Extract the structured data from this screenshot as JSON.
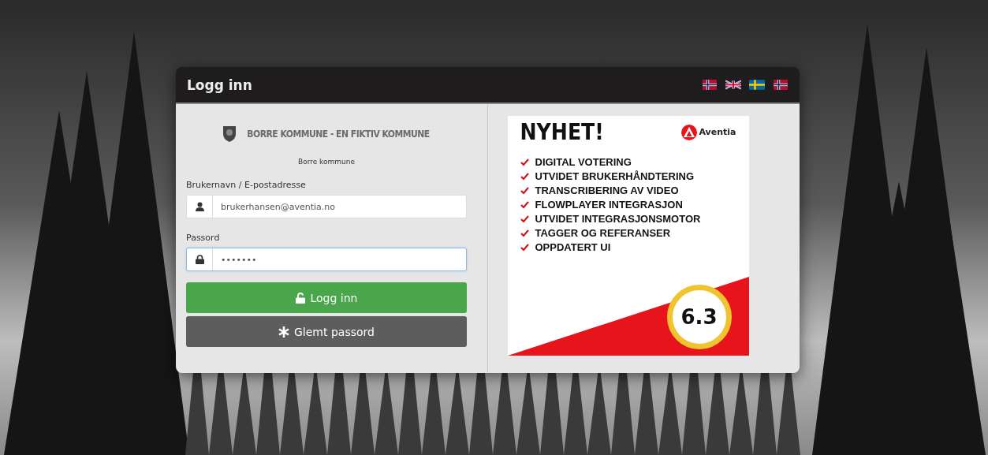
{
  "dialog": {
    "title": "Logg inn",
    "flags": [
      {
        "kind": "norway"
      },
      {
        "kind": "uk"
      },
      {
        "kind": "sweden"
      },
      {
        "kind": "norway"
      }
    ]
  },
  "login": {
    "org_banner": "BORRE KOMMUNE - EN FIKTIV KOMMUNE",
    "org_name": "Borre kommune",
    "username_label": "Brukernavn / E-postadresse",
    "username_value": "brukerhansen@aventia.no",
    "password_label": "Passord",
    "password_value": "•••••••",
    "password_focused": true,
    "login_button": "Logg inn",
    "forgot_button": "Glemt passord"
  },
  "news": {
    "heading": "NYHET!",
    "brand": "Aventia",
    "items": [
      "DIGITAL VOTERING",
      "UTVIDET BRUKERHÅNDTERING",
      "TRANSCRIBERING AV VIDEO",
      "FLOWPLAYER INTEGRASJON",
      "UTVIDET INTEGRASJONSMOTOR",
      "TAGGER OG REFERANSER",
      "OPPDATERT UI"
    ],
    "version": "6.3"
  }
}
